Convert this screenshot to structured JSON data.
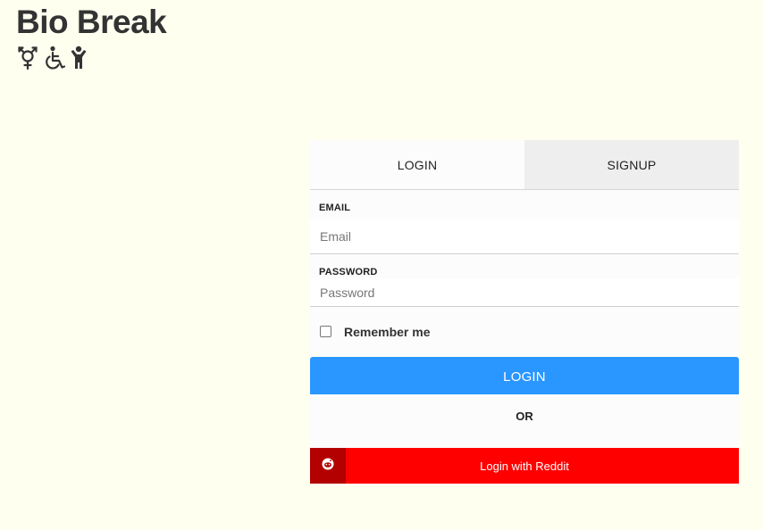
{
  "app": {
    "title": "Bio Break",
    "icons": [
      "transgender-icon",
      "wheelchair-icon",
      "child-icon"
    ]
  },
  "auth": {
    "tabs": [
      {
        "label": "LOGIN",
        "active": true
      },
      {
        "label": "SIGNUP",
        "active": false
      }
    ],
    "email": {
      "label": "EMAIL",
      "placeholder": "Email",
      "value": ""
    },
    "password": {
      "label": "PASSWORD",
      "placeholder": "Password",
      "value": ""
    },
    "remember": {
      "label": "Remember me",
      "checked": false
    },
    "login_button": "LOGIN",
    "separator": "OR",
    "reddit_button": "Login with Reddit"
  },
  "colors": {
    "background": "#fffff0",
    "primary_button": "#2a96ff",
    "reddit_button": "#ff0000",
    "reddit_icon_box": "#b30000"
  }
}
